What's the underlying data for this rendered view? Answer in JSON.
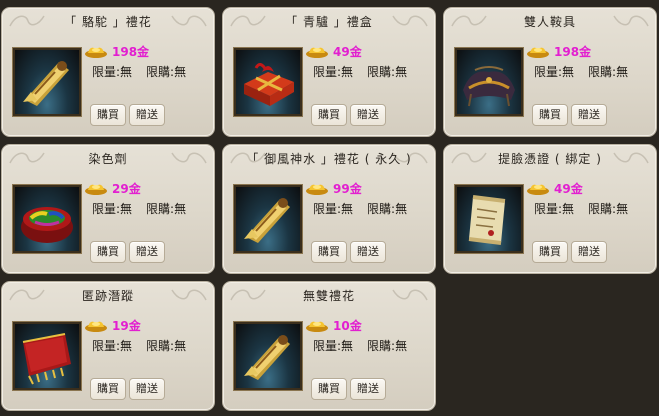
{
  "common": {
    "limit_qty": "限量:無",
    "limit_buy": "限購:無",
    "buy_label": "購買",
    "gift_label": "贈送"
  },
  "colors": {
    "price": "#e21fd0",
    "card_bg": "#dcd6c9"
  },
  "items": [
    {
      "name": "「 駱駝 」禮花",
      "price": "198金",
      "icon": "firework-gold-icon"
    },
    {
      "name": "「 青驢 」禮盒",
      "price": "49金",
      "icon": "red-gift-box-icon"
    },
    {
      "name": "雙人鞍具",
      "price": "198金",
      "icon": "saddle-icon"
    },
    {
      "name": "染色劑",
      "price": "29金",
      "icon": "dye-bowl-icon"
    },
    {
      "name": "「 御風神水 」禮花 ( 永久 )",
      "price": "99金",
      "icon": "firework-gold-icon"
    },
    {
      "name": "提臉憑證 ( 綁定 )",
      "price": "49金",
      "icon": "scroll-icon"
    },
    {
      "name": "匿跡潛蹤",
      "price": "19金",
      "icon": "red-cloth-icon"
    },
    {
      "name": "無雙禮花",
      "price": "10金",
      "icon": "firework-gold-icon"
    }
  ]
}
